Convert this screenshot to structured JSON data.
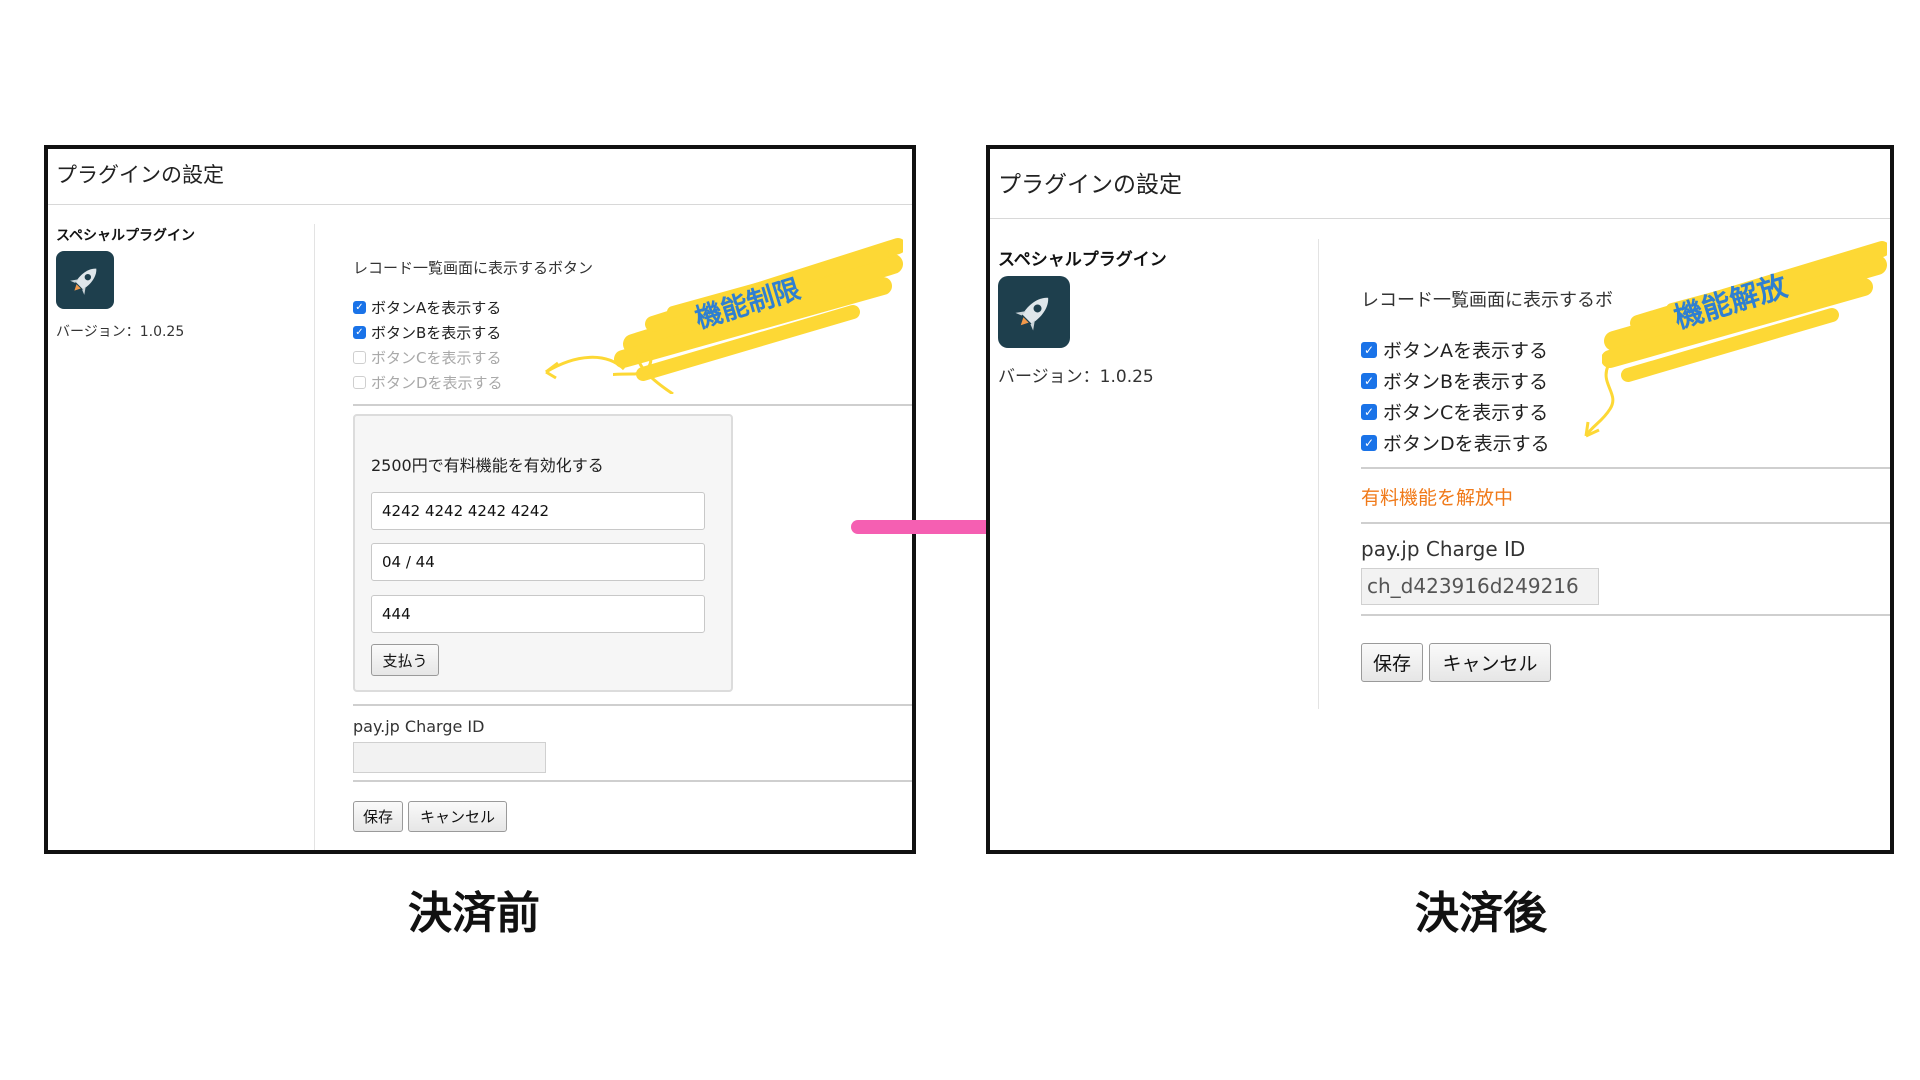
{
  "before": {
    "window_title": "プラグインの設定",
    "plugin_name": "スペシャルプラグイン",
    "version": "バージョン：1.0.25",
    "buttons_section_label": "レコード一覧画面に表示するボタン",
    "checkboxes": [
      {
        "label": "ボタンAを表示する",
        "checked": true,
        "disabled": false
      },
      {
        "label": "ボタンBを表示する",
        "checked": true,
        "disabled": false
      },
      {
        "label": "ボタンCを表示する",
        "checked": false,
        "disabled": true
      },
      {
        "label": "ボタンDを表示する",
        "checked": false,
        "disabled": true
      }
    ],
    "annotation": "機能制限",
    "payment": {
      "title": "2500円で有料機能を有効化する",
      "card_number": "4242 4242 4242 4242",
      "expiry": "04 / 44",
      "cvc": "444",
      "pay_button": "支払う"
    },
    "charge_id_label": "pay.jp Charge ID",
    "charge_id_value": "",
    "save_button": "保存",
    "cancel_button": "キャンセル"
  },
  "after": {
    "window_title": "プラグインの設定",
    "plugin_name": "スペシャルプラグイン",
    "version": "バージョン：1.0.25",
    "buttons_section_label": "レコード一覧画面に表示するボ",
    "checkboxes": [
      {
        "label": "ボタンAを表示する",
        "checked": true,
        "disabled": false
      },
      {
        "label": "ボタンBを表示する",
        "checked": true,
        "disabled": false
      },
      {
        "label": "ボタンCを表示する",
        "checked": true,
        "disabled": false
      },
      {
        "label": "ボタンDを表示する",
        "checked": true,
        "disabled": false
      }
    ],
    "annotation": "機能解放",
    "paid_status": "有料機能を解放中",
    "charge_id_label": "pay.jp Charge ID",
    "charge_id_value": "ch_d423916d249216",
    "save_button": "保存",
    "cancel_button": "キャンセル"
  },
  "captions": {
    "before": "決済前",
    "after": "決済後"
  },
  "colors": {
    "checkbox_accent": "#1a73e8",
    "highlighter": "#fdd835",
    "annotation_text": "#2f7fd1",
    "transition_arrow": "#f55fb2",
    "paid_status": "#f07a1a"
  },
  "icons": {
    "plugin_icon": "rocket-icon",
    "transition": "arrow-right-icon"
  }
}
